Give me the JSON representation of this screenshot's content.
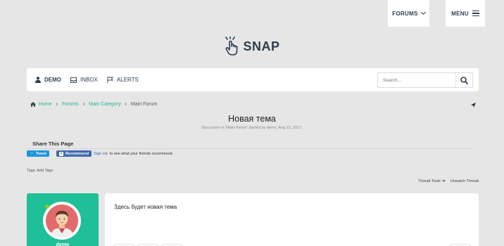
{
  "topnav": {
    "forums_label": "FORUMS",
    "menu_label": "MENU"
  },
  "logo": {
    "text": "SNAP"
  },
  "navbar": {
    "user_label": "DEMO",
    "inbox_label": "INBOX",
    "alerts_label": "ALERTS",
    "search_placeholder": "Search..."
  },
  "breadcrumb": {
    "items": [
      "Home",
      "Forums",
      "Main Category"
    ],
    "current": "Main Forum"
  },
  "thread": {
    "title": "Новая тема",
    "description": "Discussion in 'Main Forum' started by demo, Aug 13, 2017."
  },
  "share": {
    "heading": "Share This Page",
    "tweet_label": "Tweet",
    "recommend_label": "Recommend",
    "signup_link": "Sign Up",
    "signup_text": "to see what your friends recommend."
  },
  "tags": {
    "label": "Tags:",
    "add_link": "Add Tags"
  },
  "thread_tools": {
    "tools_label": "Thread Tools",
    "unwatch_label": "Unwatch Thread"
  },
  "post": {
    "username": "demo",
    "text": "Здесь будет новая тема"
  },
  "colors": {
    "accent": "#1fbf98",
    "link": "#1fb59a",
    "navy": "#2d3e50",
    "facebook": "#4267b2",
    "twitter": "#1b95e0"
  }
}
